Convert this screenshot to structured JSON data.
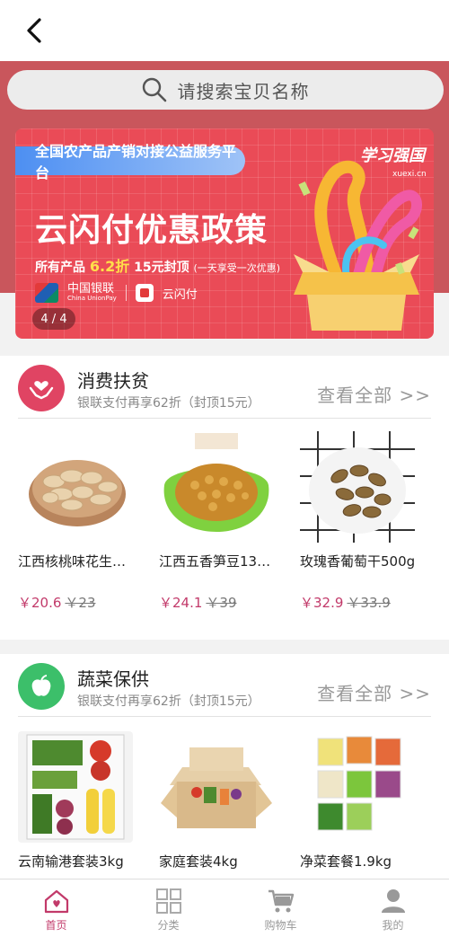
{
  "search": {
    "placeholder": "请搜索宝贝名称"
  },
  "banner": {
    "platform": "全国农产品产销对接公益服务平台",
    "brand": "学习强国",
    "brand_sub": "xuexi.cn",
    "title": "云闪付优惠政策",
    "sub_prefix": "所有产品",
    "sub_discount": "6.2折",
    "sub_cap": "15元封顶",
    "sub_note": "(一天享受一次优惠)",
    "logo_unionpay": "中国银联",
    "logo_unionpay_en": "China UnionPay",
    "logo_ysf": "云闪付",
    "page_indicator": "4 / 4",
    "colors": {
      "background": "#ea4b57",
      "pill": "#4d8ff2",
      "highlight": "#ffe04a"
    }
  },
  "sections": [
    {
      "title": "消费扶贫",
      "subtitle": "银联支付再享62折（封顶15元）",
      "more": "查看全部 >>",
      "icon": "hands-heart-icon",
      "icon_color": "#e04463",
      "products": [
        {
          "name": "江西核桃味花生…",
          "price": "￥20.6",
          "old_price": "￥23",
          "image": "peanuts"
        },
        {
          "name": "江西五香笋豆13…",
          "price": "￥24.1",
          "old_price": "￥39",
          "image": "spiced-beans"
        },
        {
          "name": "玫瑰香葡萄干500g",
          "price": "￥32.9",
          "old_price": "￥33.9",
          "image": "raisins"
        }
      ]
    },
    {
      "title": "蔬菜保供",
      "subtitle": "银联支付再享62折（封顶15元）",
      "more": "查看全部 >>",
      "icon": "apple-icon",
      "icon_color": "#3cbf6a",
      "products": [
        {
          "name": "云南输港套装3kg",
          "image": "vegetable-box"
        },
        {
          "name": "家庭套装4kg",
          "image": "cardboard-box"
        },
        {
          "name": "净菜套餐1.9kg",
          "image": "packaged-veggies"
        }
      ]
    }
  ],
  "nav": {
    "items": [
      {
        "label": "首页",
        "icon": "home-icon",
        "active": true
      },
      {
        "label": "分类",
        "icon": "grid-icon",
        "active": false
      },
      {
        "label": "购物车",
        "icon": "cart-icon",
        "active": false
      },
      {
        "label": "我的",
        "icon": "user-icon",
        "active": false
      }
    ],
    "active_color": "#c23a6a"
  }
}
